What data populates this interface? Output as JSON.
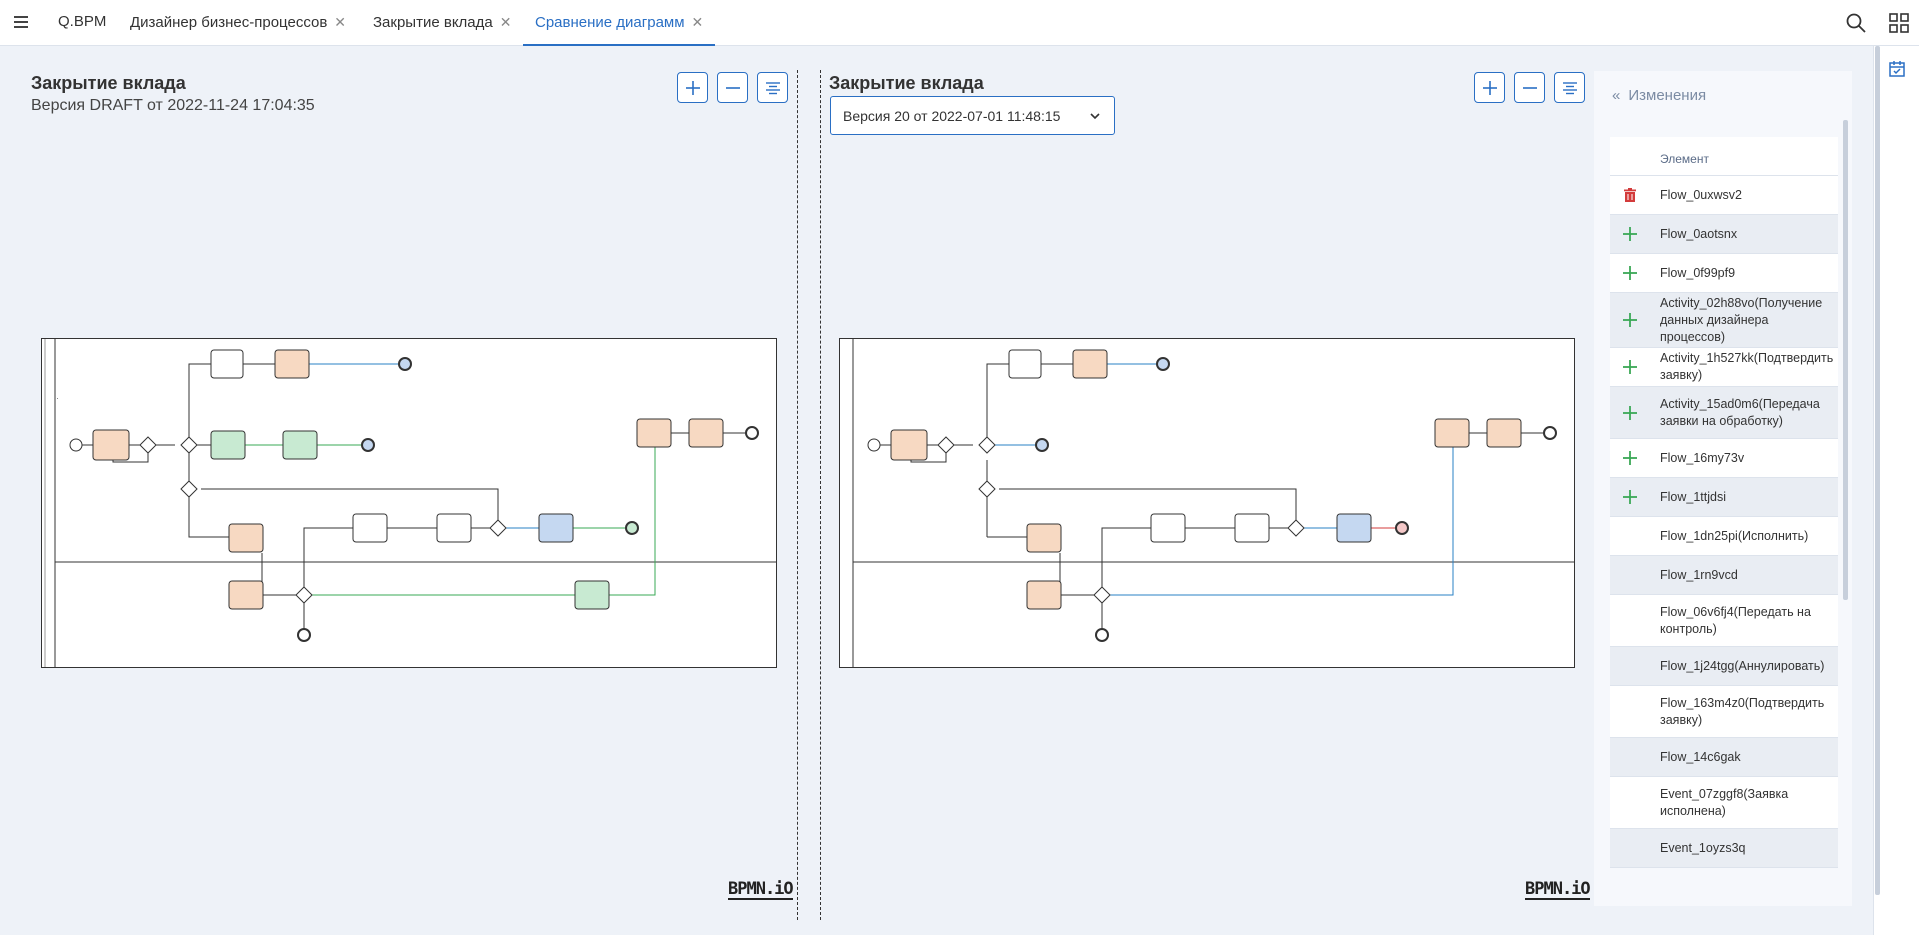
{
  "app": {
    "brand": "Q.BPM"
  },
  "tabs": [
    {
      "label": "Дизайнер бизнес-процессов",
      "closable": true
    },
    {
      "label": "Закрытие вклада",
      "closable": true
    },
    {
      "label": "Сравнение диаграмм",
      "closable": true,
      "active": true
    }
  ],
  "icons": {
    "menu": "menu-icon",
    "search": "search-icon",
    "apps": "apps-grid-icon",
    "calendar": "calendar-check-icon"
  },
  "left": {
    "title": "Закрытие вклада",
    "subtitle": "Версия DRAFT от 2022-11-24 17:04:35"
  },
  "right": {
    "title": "Закрытие вклада",
    "version_selected": "Версия 20 от 2022-07-01 11:48:15"
  },
  "bpmn_logo": "BPMN.iO",
  "changes": {
    "header": "Изменения",
    "column": "Элемент",
    "rows": [
      {
        "type": "deleted",
        "label": "Flow_0uxwsv2"
      },
      {
        "type": "added",
        "label": "Flow_0aotsnx"
      },
      {
        "type": "added",
        "label": "Flow_0f99pf9"
      },
      {
        "type": "added",
        "label": "Activity_02h88vo(Получение данных дизайнера процессов)"
      },
      {
        "type": "added",
        "label": "Activity_1h527kk(Подтвердить заявку)"
      },
      {
        "type": "added",
        "label": "Activity_15ad0m6(Передача заявки на обработку)"
      },
      {
        "type": "added",
        "label": "Flow_16my73v"
      },
      {
        "type": "added",
        "label": "Flow_1ttjdsi"
      },
      {
        "type": "changed",
        "label": "Flow_1dn25pi(Исполнить)"
      },
      {
        "type": "changed",
        "label": "Flow_1rn9vcd"
      },
      {
        "type": "changed",
        "label": "Flow_06v6fj4(Передать на контроль)"
      },
      {
        "type": "changed",
        "label": "Flow_1j24tgg(Аннулировать)"
      },
      {
        "type": "changed",
        "label": "Flow_163m4z0(Подтвердить заявку)"
      },
      {
        "type": "changed",
        "label": "Flow_14c6gak"
      },
      {
        "type": "changed",
        "label": "Event_07zggf8(Заявка исполнена)"
      },
      {
        "type": "changed",
        "label": "Event_1oyzs3q"
      }
    ]
  },
  "colors": {
    "accent": "#2a6fc4",
    "added": "#3aa856",
    "deleted": "#d33b3b",
    "task_orange": "#f7d9c2",
    "task_green": "#c8ead2",
    "task_blue": "#c5d8f1"
  }
}
